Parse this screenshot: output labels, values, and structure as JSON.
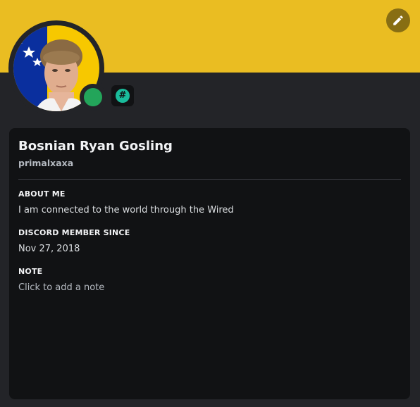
{
  "profile": {
    "display_name": "Bosnian Ryan Gosling",
    "username": "primalxaxa",
    "status": "online",
    "badge_symbol": "#"
  },
  "about_me": {
    "title": "ABOUT ME",
    "text": "I am connected to the world through the Wired"
  },
  "member_since": {
    "title": "DISCORD MEMBER SINCE",
    "date": "Nov 27, 2018"
  },
  "note": {
    "title": "NOTE",
    "placeholder": "Click to add a note"
  },
  "colors": {
    "banner": "#eabd22",
    "status_online": "#23a55a",
    "badge": "#1abc9c",
    "card_bg": "#111214",
    "page_bg": "#232428"
  },
  "icons": {
    "edit": "pencil-icon",
    "badge": "hashtag-badge-icon"
  }
}
